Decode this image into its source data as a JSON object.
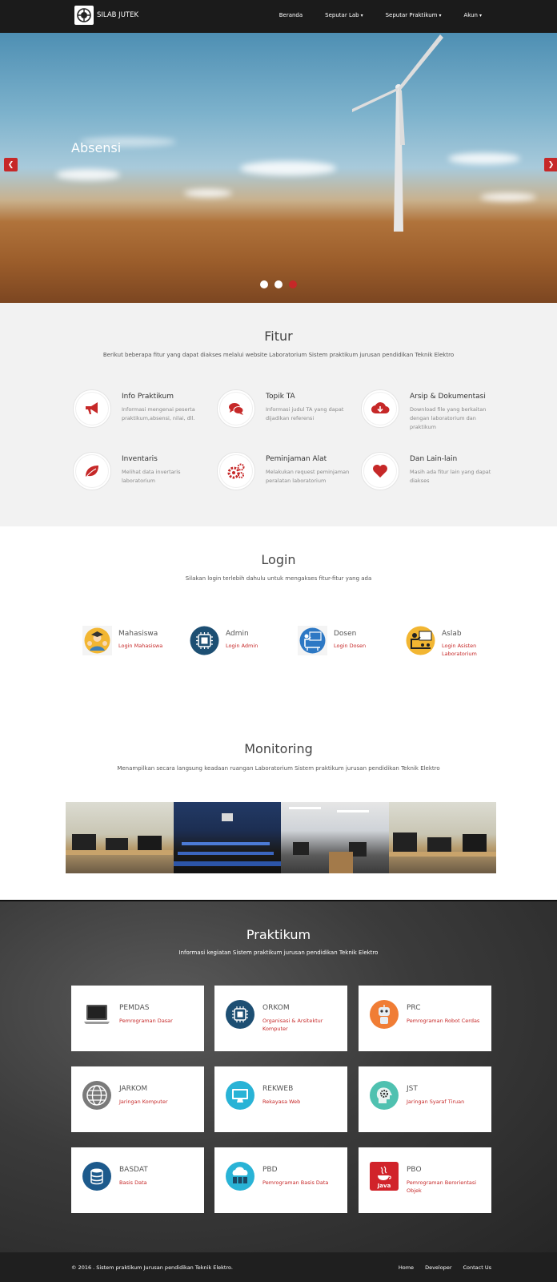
{
  "navbar": {
    "brand": "SILAB JUTEK",
    "items": [
      {
        "label": "Beranda",
        "caret": false
      },
      {
        "label": "Seputar Lab",
        "caret": true
      },
      {
        "label": "Seputar Praktikum",
        "caret": true
      },
      {
        "label": "Akun",
        "caret": true
      }
    ]
  },
  "hero": {
    "caption": "Absensi",
    "prev_icon": "chevron-left-icon",
    "next_icon": "chevron-right-icon",
    "slides": 3,
    "active_slide": 3
  },
  "fitur": {
    "title": "Fitur",
    "subtitle": "Berikut beberapa fitur yang dapat diakses melalui website Laboratorium Sistem praktikum jurusan pendidikan Teknik Elektro",
    "items": [
      {
        "title": "Info Praktikum",
        "desc": "Informasi mengenai peserta praktikum,absensi, nilai, dll.",
        "icon": "megaphone-icon"
      },
      {
        "title": "Topik TA",
        "desc": "Informasi judul TA yang dapat dijadikan referensi",
        "icon": "comments-icon"
      },
      {
        "title": "Arsip & Dokumentasi",
        "desc": "Download file yang berkaitan dengan laboratorium dan praktikum",
        "icon": "cloud-download-icon"
      },
      {
        "title": "Inventaris",
        "desc": "Melihat data invertaris laboratorium",
        "icon": "leaf-icon"
      },
      {
        "title": "Peminjaman Alat",
        "desc": "Melakukan request peminjaman peralatan laboratorium",
        "icon": "cogs-icon"
      },
      {
        "title": "Dan Lain-lain",
        "desc": "Masih ada fitur lain yang dapat diakses",
        "icon": "heart-icon"
      }
    ]
  },
  "login": {
    "title": "Login",
    "subtitle": "Silakan login terlebih dahulu untuk mengakses fitur-fitur yang ada",
    "items": [
      {
        "title": "Mahasiswa",
        "link": "Login Mahasiswa",
        "icon": "student-icon"
      },
      {
        "title": "Admin",
        "link": "Login Admin",
        "icon": "cpu-icon"
      },
      {
        "title": "Dosen",
        "link": "Login Dosen",
        "icon": "teacher-icon"
      },
      {
        "title": "Aslab",
        "link": "Login Asisten Laboratorium",
        "icon": "assistant-icon"
      }
    ]
  },
  "monitoring": {
    "title": "Monitoring",
    "subtitle": "Menampilkan secara langsung keadaan ruangan Laboratorium Sistem praktikum jurusan pendidikan Teknik Elektro"
  },
  "praktikum": {
    "title": "Praktikum",
    "subtitle": "Informasi kegiatan Sistem praktikum jurusan pendidikan Teknik Elektro",
    "cards": [
      {
        "title": "PEMDAS",
        "desc": "Pemrograman Dasar",
        "icon": "laptop-icon"
      },
      {
        "title": "ORKOM",
        "desc": "Organisasi & Arsitektur Komputer",
        "icon": "chip-icon"
      },
      {
        "title": "PRC",
        "desc": "Pemrograman Robot Cerdas",
        "icon": "robot-icon"
      },
      {
        "title": "JARKOM",
        "desc": "Jaringan Komputer",
        "icon": "globe-icon"
      },
      {
        "title": "REKWEB",
        "desc": "Rekayasa Web",
        "icon": "monitor-icon"
      },
      {
        "title": "JST",
        "desc": "Jaringan Syaraf Tiruan",
        "icon": "brain-gear-icon"
      },
      {
        "title": "BASDAT",
        "desc": "Basis Data",
        "icon": "database-icon"
      },
      {
        "title": "PBD",
        "desc": "Pemrograman Basis Data",
        "icon": "cloud-server-icon"
      },
      {
        "title": "PBO",
        "desc": "Pemrograman Berorientasi Objek",
        "icon": "java-icon"
      }
    ]
  },
  "footer": {
    "copyright": "© 2016 . Sistem praktikum Jurusan pendidikan Teknik Elektro.",
    "links": [
      "Home",
      "Developer",
      "Contact Us"
    ]
  },
  "colors": {
    "accent": "#c62828",
    "navbar": "#1b1b1b",
    "fitur_bg": "#f2f2f2",
    "footer": "#1f1f1f"
  }
}
